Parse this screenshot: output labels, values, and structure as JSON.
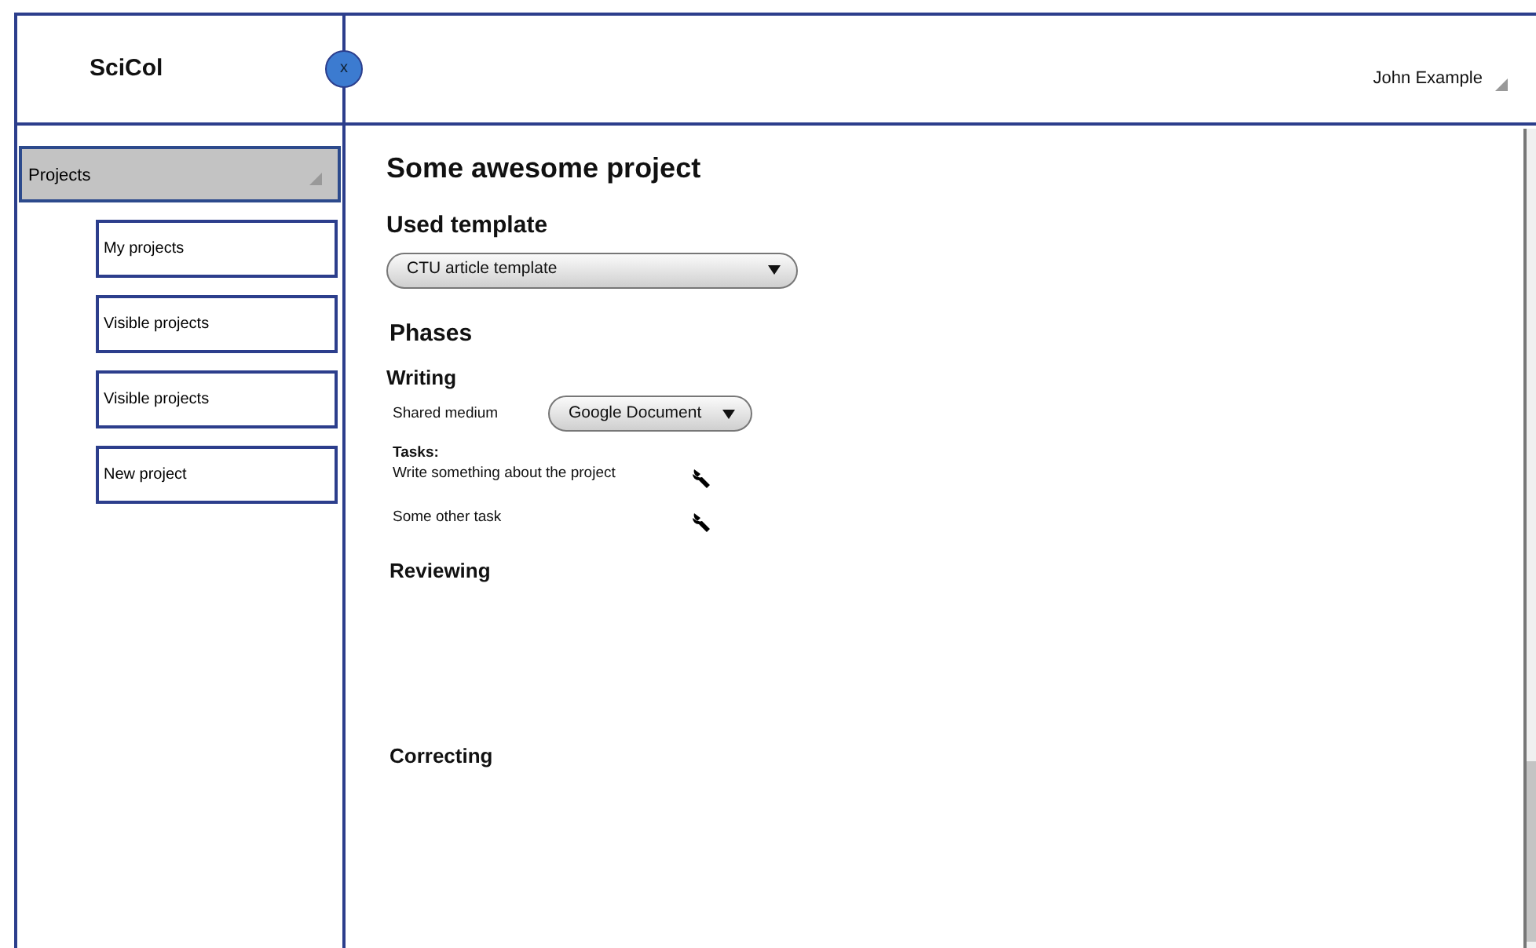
{
  "app_title": "SciCol",
  "close_button": "x",
  "user_menu": {
    "name": "John Example"
  },
  "sidebar": {
    "items": [
      {
        "label": "Projects",
        "expanded": true,
        "children": [
          {
            "label": "My projects"
          },
          {
            "label": "Visible projects"
          },
          {
            "label": "Visible projects"
          },
          {
            "label": "New project"
          }
        ]
      }
    ]
  },
  "project": {
    "title": "Some awesome project",
    "template_heading": "Used template",
    "template": "CTU article template",
    "phases_heading": "Phases",
    "phases": [
      {
        "name": "Writing",
        "medium_label": "Shared medium",
        "medium": "Google Document",
        "tasks_label": "Tasks:",
        "tasks": [
          {
            "name": "Write something about the project"
          },
          {
            "name": "Some other task"
          }
        ]
      },
      {
        "name": "Reviewing"
      },
      {
        "name": "Correcting"
      }
    ]
  }
}
